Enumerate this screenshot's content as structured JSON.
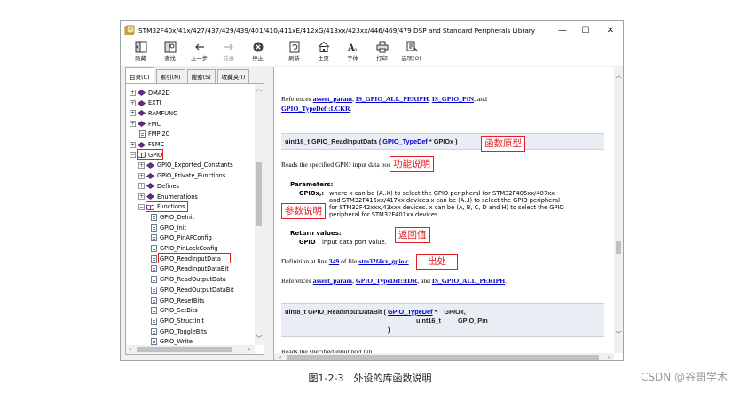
{
  "window": {
    "title": "STM32F40x/41x/427/437/429/439/401/410/411xE/412xG/413xx/423xx/446/469/479 DSP and Standard Peripherals Library",
    "controls": [
      "—",
      "☐",
      "✕"
    ]
  },
  "toolbar": {
    "buttons": [
      {
        "label": "隐藏",
        "icon": "hide-icon",
        "disabled": false
      },
      {
        "label": "查找",
        "icon": "find-icon",
        "disabled": false
      },
      {
        "label": "上一步",
        "icon": "back-arrow-icon",
        "disabled": false
      },
      {
        "label": "前进",
        "icon": "forward-arrow-icon",
        "disabled": true
      },
      {
        "label": "停止",
        "icon": "stop-icon",
        "disabled": false
      },
      {
        "label": "刷新",
        "icon": "refresh-icon",
        "disabled": false
      },
      {
        "label": "主页",
        "icon": "home-icon",
        "disabled": false
      },
      {
        "label": "字体",
        "icon": "font-icon",
        "disabled": false
      },
      {
        "label": "打印",
        "icon": "print-icon",
        "disabled": false
      },
      {
        "label": "选项(O)",
        "icon": "options-icon",
        "disabled": false
      }
    ]
  },
  "left_tabs": [
    "目录(C)",
    "索引(N)",
    "搜索(S)",
    "收藏夹(I)"
  ],
  "tree": [
    {
      "label": "DMA2D",
      "type": "book",
      "expander": "⊞",
      "level": 0
    },
    {
      "label": "EXTI",
      "type": "book",
      "expander": "⊞",
      "level": 0
    },
    {
      "label": "RAMFUNC",
      "type": "book",
      "expander": "⊞",
      "level": 0
    },
    {
      "label": "FMC",
      "type": "book",
      "expander": "⊞",
      "level": 0
    },
    {
      "label": "FMPI2C",
      "type": "page",
      "expander": "",
      "level": 0
    },
    {
      "label": "FSMC",
      "type": "book",
      "expander": "⊞",
      "level": 0
    },
    {
      "label": "GPIO",
      "type": "open-book",
      "expander": "⊟",
      "level": 0
    },
    {
      "label": "GPIO_Exported_Constants",
      "type": "book",
      "expander": "⊞",
      "level": 1
    },
    {
      "label": "GPIO_Private_Functions",
      "type": "book",
      "expander": "⊞",
      "level": 1
    },
    {
      "label": "Defines",
      "type": "book",
      "expander": "⊞",
      "level": 1
    },
    {
      "label": "Enumerations",
      "type": "book",
      "expander": "⊞",
      "level": 1
    },
    {
      "label": "Functions",
      "type": "open-book",
      "expander": "⊟",
      "level": 1
    },
    {
      "label": "GPIO_DeInit",
      "type": "page",
      "expander": "",
      "level": 2
    },
    {
      "label": "GPIO_Init",
      "type": "page",
      "expander": "",
      "level": 2
    },
    {
      "label": "GPIO_PinAFConfig",
      "type": "page",
      "expander": "",
      "level": 2
    },
    {
      "label": "GPIO_PinLockConfig",
      "type": "page",
      "expander": "",
      "level": 2
    },
    {
      "label": "GPIO_ReadInputData",
      "type": "page",
      "expander": "",
      "level": 2
    },
    {
      "label": "GPIO_ReadInputDataBit",
      "type": "page",
      "expander": "",
      "level": 2
    },
    {
      "label": "GPIO_ReadOutputData",
      "type": "page",
      "expander": "",
      "level": 2
    },
    {
      "label": "GPIO_ReadOutputDataBit",
      "type": "page",
      "expander": "",
      "level": 2
    },
    {
      "label": "GPIO_ResetBits",
      "type": "page",
      "expander": "",
      "level": 2
    },
    {
      "label": "GPIO_SetBits",
      "type": "page",
      "expander": "",
      "level": 2
    },
    {
      "label": "GPIO_StructInit",
      "type": "page",
      "expander": "",
      "level": 2
    },
    {
      "label": "GPIO_ToggleBits",
      "type": "page",
      "expander": "",
      "level": 2
    },
    {
      "label": "GPIO_Write",
      "type": "page",
      "expander": "",
      "level": 2
    }
  ],
  "content": {
    "ref_top": {
      "prefix": "References ",
      "link1": "assert_param",
      "sep1": ", ",
      "link2": "IS_GPIO_ALL_PERIPH",
      "sep2": ", ",
      "link3": "IS_GPIO_PIN",
      "suffix": ", and",
      "link4": "GPIO_TypeDef::LCKR",
      "end": "."
    },
    "func1": {
      "prototype_prefix": "uint16_t GPIO_ReadInputData (",
      "prototype_link": "GPIO_TypeDef",
      "prototype_suffix": "* GPIOx )",
      "description": "Reads the specified GPIO input data port.",
      "params_heading": "Parameters:",
      "param_name": "GPIOx,:",
      "param_lines": [
        "where x can be (A..K) to select the GPIO peripheral for STM32F405xx/407xx",
        "and STM32F415xx/417xx devices x can be (A..I) to select the GPIO peripheral",
        "for STM32F42xxx/43xxx devices. x can be (A, B, C, D and H) to select the GPIO",
        "peripheral for STM32F401xx devices."
      ],
      "return_heading": "Return values:",
      "return_name": "GPIO",
      "return_text": "input data port value.",
      "definition_prefix": "Definition at line ",
      "definition_line": "349",
      "definition_mid": " of file ",
      "definition_file": "stm32f4xx_gpio.c",
      "definition_end": ".",
      "refs_prefix": "References ",
      "refs_link1": "assert_param",
      "refs_link2": "GPIO_TypeDef::IDR",
      "refs_and": ", and ",
      "refs_link3": "IS_GPIO_ALL_PERIPH",
      "refs_end": "."
    },
    "func2": {
      "line1_prefix": "uint8_t GPIO_ReadInputDataBit (",
      "line1_link": "GPIO_TypeDef",
      "line1_star": "*",
      "line1_arg": "GPIOx,",
      "line2_type": "uint16_t",
      "line2_arg": "GPIO_Pin",
      "line3": ")",
      "description": "Reads the specified input port pin."
    }
  },
  "annotations": {
    "prototype": "函数原型",
    "description": "功能说明",
    "parameters": "参数说明",
    "return": "返回值",
    "source": "出处"
  },
  "caption": "图1-2-3　外设的库函数说明",
  "watermark": "CSDN @谷哥学术",
  "colors": {
    "annotation": "#e21e26",
    "link": "#0000cc",
    "band": "#e8eef3"
  }
}
